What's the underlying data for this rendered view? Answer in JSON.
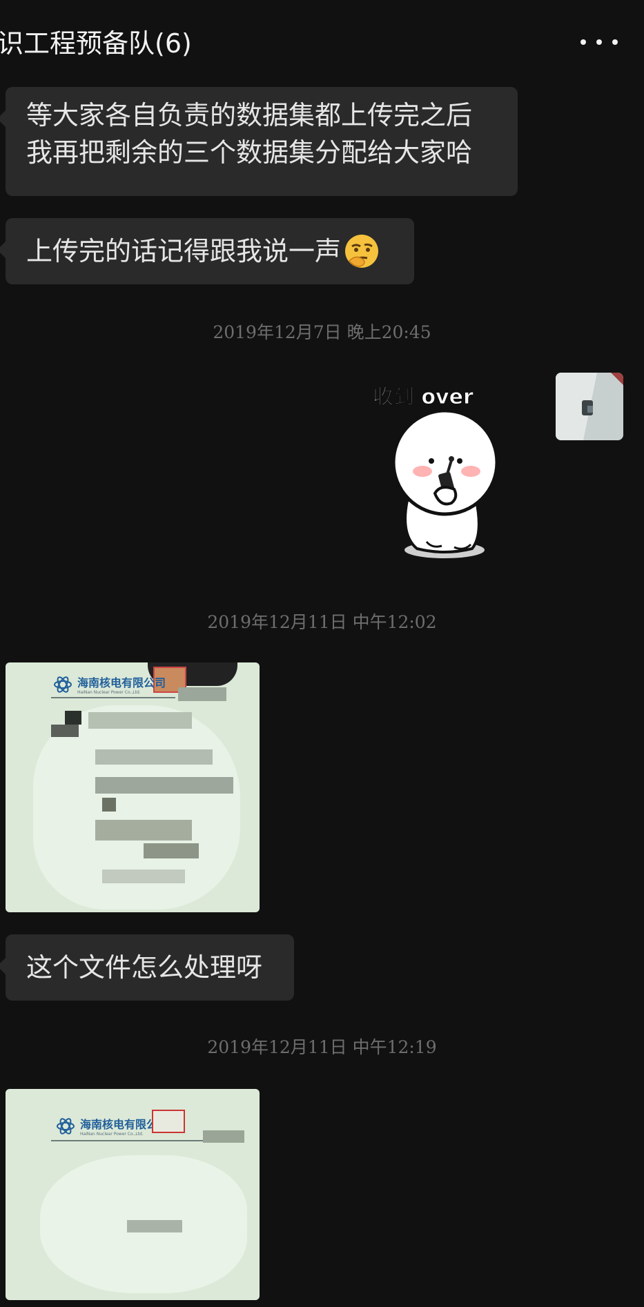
{
  "header": {
    "title": "识工程预备队(6)",
    "more_icon": "more-dots-icon"
  },
  "messages": [
    {
      "type": "text",
      "lines": [
        "等大家各自负责的数据集都上传完之后",
        "我再把剩余的三个数据集分配给大家哈"
      ]
    },
    {
      "type": "text",
      "text": "上传完的话记得跟我说一声",
      "emoji": "thinking-face-emoji"
    },
    {
      "type": "timestamp",
      "text": "2019年12月7日 晚上20:45"
    },
    {
      "type": "sticker",
      "caption": "收到 over",
      "icon": "walkie-talkie-sticker"
    },
    {
      "type": "timestamp",
      "text": "2019年12月11日 中午12:02"
    },
    {
      "type": "image",
      "logo_text": "海南核电有限公司",
      "logo_sub": "HaiNan Nuclear Power Co.,Ltd."
    },
    {
      "type": "text",
      "text": "这个文件怎么处理呀"
    },
    {
      "type": "timestamp",
      "text": "2019年12月11日 中午12:19"
    },
    {
      "type": "image",
      "logo_text": "海南核电有限公司",
      "logo_sub": "HaiNan Nuclear Power Co.,Ltd."
    }
  ],
  "colors": {
    "background": "#111111",
    "bubble": "#2a2a2a",
    "text": "#e6e6e6",
    "timestamp": "#6e6e6e"
  }
}
